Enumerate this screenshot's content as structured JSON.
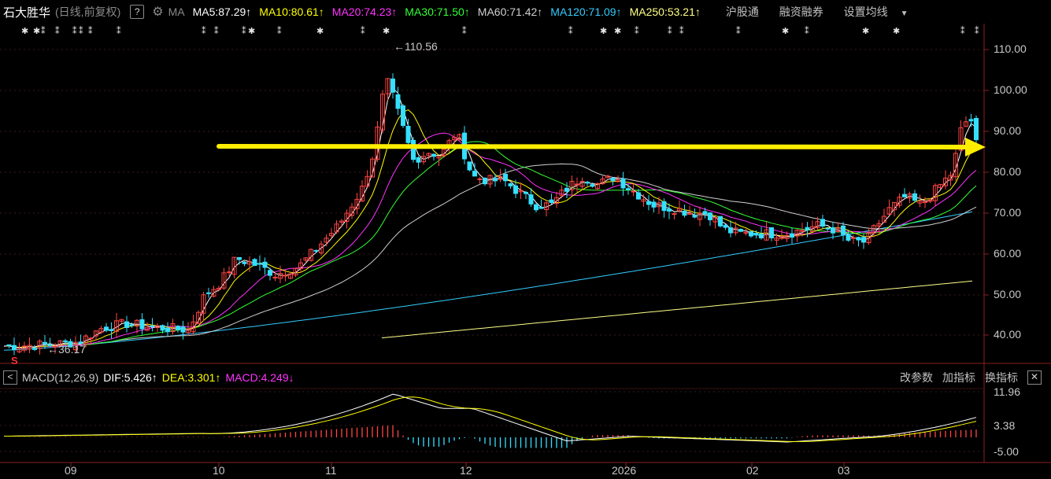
{
  "header": {
    "stock_name": "石大胜华",
    "subtitle": "(日线,前复权)",
    "help_label": "?",
    "ma_label": "MA",
    "ma_items": [
      {
        "text": "MA5:87.29",
        "arrow": "↑",
        "color": "#ffffff"
      },
      {
        "text": "MA10:80.61",
        "arrow": "↑",
        "color": "#ffff00"
      },
      {
        "text": "MA20:74.23",
        "arrow": "↑",
        "color": "#ff33ff"
      },
      {
        "text": "MA30:71.50",
        "arrow": "↑",
        "color": "#33ff33"
      },
      {
        "text": "MA60:71.42",
        "arrow": "↑",
        "color": "#d0d0d0"
      },
      {
        "text": "MA120:71.09",
        "arrow": "↑",
        "color": "#33ccff"
      },
      {
        "text": "MA250:53.21",
        "arrow": "↑",
        "color": "#ffff88"
      }
    ],
    "links": [
      "沪股通",
      "融资融券",
      "设置均线"
    ]
  },
  "price_axis": {
    "ticks": [
      "110.00",
      "100.00",
      "90.00",
      "80.00",
      "70.00",
      "60.00",
      "50.00",
      "40.00"
    ]
  },
  "annotations": {
    "high": "110.56",
    "low": "36.17",
    "s_mark": "S"
  },
  "macd": {
    "label": "MACD(12,26,9)",
    "dif": "DIF:5.426",
    "dif_arrow": "↑",
    "dea": "DEA:3.301",
    "dea_arrow": "↑",
    "macd_val": "MACD:4.249",
    "macd_arrow": "↓",
    "tools": [
      "改参数",
      "加指标",
      "换指标"
    ],
    "close": "✕",
    "ticks": [
      "11.96",
      "3.38",
      "-5.00"
    ]
  },
  "x_axis": {
    "labels": [
      "09",
      "10",
      "11",
      "12",
      "2026",
      "02",
      "03"
    ]
  },
  "colors": {
    "up": "#ff4444",
    "down": "#33e0ff",
    "arrow": "#ffee00",
    "bg": "#000000"
  }
}
